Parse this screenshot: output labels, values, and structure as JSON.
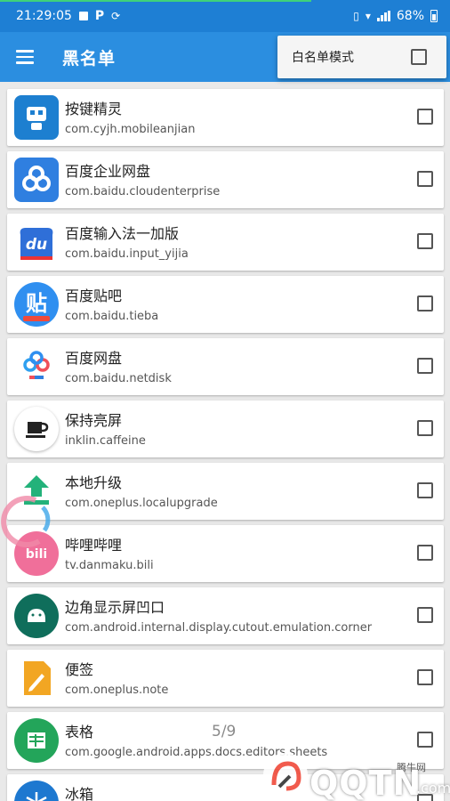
{
  "status_bar": {
    "time": "21:29:05",
    "battery": "68%",
    "p_icon": "P",
    "icons": [
      "image-icon",
      "p-icon",
      "sync-icon",
      "phone-icon",
      "wifi-icon",
      "signal-icon",
      "battery-icon"
    ]
  },
  "toolbar": {
    "title": "黑名单",
    "menu_icon": "hamburger-menu-icon"
  },
  "popup": {
    "label": "白名单模式",
    "checked": false
  },
  "apps": [
    {
      "name": "按键精灵",
      "package": "com.cyjh.mobileanjian",
      "icon": "robot-icon",
      "color": "#1d7fd0",
      "checked": false
    },
    {
      "name": "百度企业网盘",
      "package": "com.baidu.cloudenterprise",
      "icon": "cloud-icon",
      "color": "#2f7fe0",
      "checked": false
    },
    {
      "name": "百度输入法一加版",
      "package": "com.baidu.input_yijia",
      "icon": "du-icon",
      "color": "#2f6fd8",
      "checked": false
    },
    {
      "name": "百度贴吧",
      "package": "com.baidu.tieba",
      "icon": "tieba-icon",
      "color": "#2f8ff0",
      "checked": false
    },
    {
      "name": "百度网盘",
      "package": "com.baidu.netdisk",
      "icon": "netdisk-icon",
      "color": "#ffffff",
      "checked": false
    },
    {
      "name": "保持亮屏",
      "package": "inklin.caffeine",
      "icon": "coffee-cup-icon",
      "color": "#ffffff",
      "checked": false
    },
    {
      "name": "本地升级",
      "package": "com.oneplus.localupgrade",
      "icon": "upload-arrow-icon",
      "color": "#ffffff",
      "checked": false
    },
    {
      "name": "哔哩哔哩",
      "package": "tv.danmaku.bili",
      "icon": "bilibili-icon",
      "color": "#f06f9a",
      "checked": false
    },
    {
      "name": "边角显示屏凹口",
      "package": "com.android.internal.display.cutout.emulation.corner",
      "icon": "android-icon",
      "color": "#0f6e5b",
      "checked": false
    },
    {
      "name": "便签",
      "package": "com.oneplus.note",
      "icon": "note-pencil-icon",
      "color": "#f2a623",
      "checked": false
    },
    {
      "name": "表格",
      "package": "com.google.android.apps.docs.editors.sheets",
      "icon": "sheets-icon",
      "color": "#23a55a",
      "checked": false
    },
    {
      "name": "冰箱",
      "package": "",
      "icon": "snowflake-icon",
      "color": "#1d78d0",
      "checked": false
    }
  ],
  "pager": "5/9",
  "watermark": {
    "text": "QQTN",
    "sub": "腾牛网",
    "domain": ".com"
  }
}
